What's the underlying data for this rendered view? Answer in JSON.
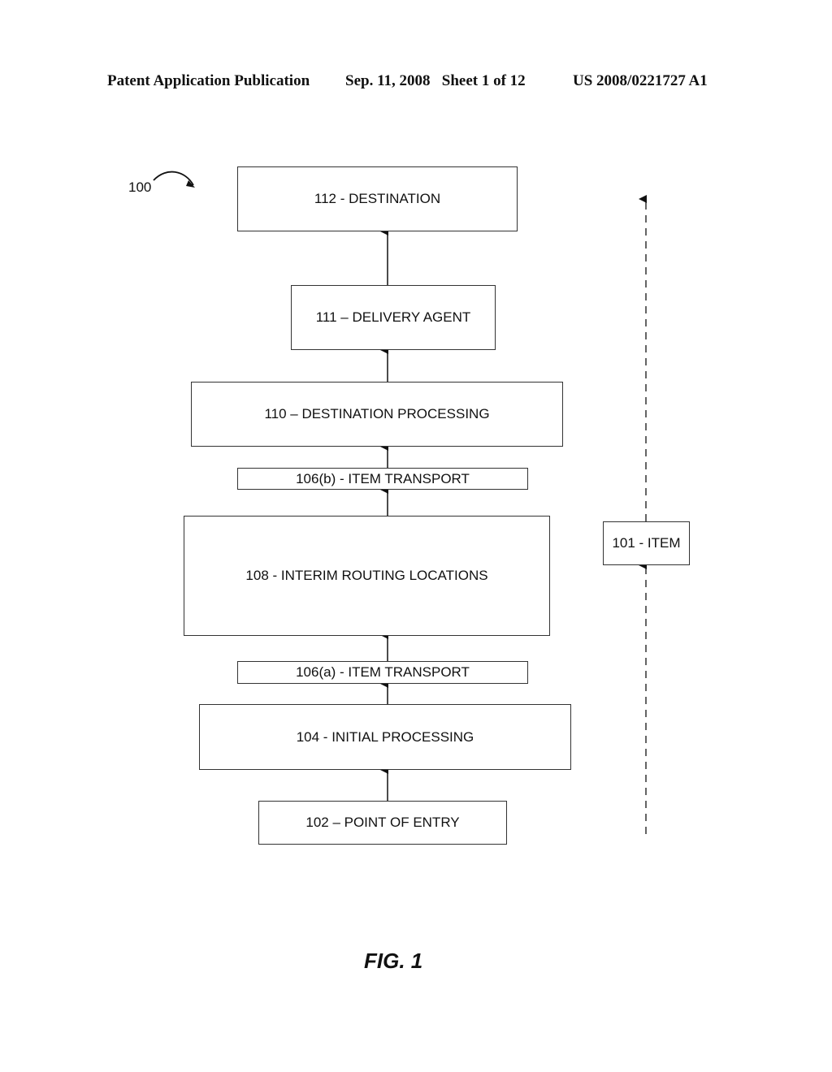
{
  "header": {
    "left": "Patent Application Publication",
    "middle": "Sep. 11, 2008   Sheet 1 of 12",
    "right": "US 2008/0221727 A1"
  },
  "figure": {
    "reference_label": "100",
    "caption": "FIG. 1",
    "boxes": {
      "destination": "112 - DESTINATION",
      "delivery_agent": "111 – DELIVERY AGENT",
      "destination_processing": "110 – DESTINATION PROCESSING",
      "item_transport_b": "106(b) - ITEM TRANSPORT",
      "interim_routing": "108 - INTERIM ROUTING LOCATIONS",
      "item_transport_a": "106(a) - ITEM TRANSPORT",
      "initial_processing": "104 - INITIAL PROCESSING",
      "point_of_entry": "102 – POINT OF ENTRY",
      "item": "101 - ITEM"
    },
    "flow_order": [
      "102 – POINT OF ENTRY",
      "104 - INITIAL PROCESSING",
      "106(a) - ITEM TRANSPORT",
      "108 - INTERIM ROUTING LOCATIONS",
      "106(b) - ITEM TRANSPORT",
      "110 – DESTINATION PROCESSING",
      "111 – DELIVERY AGENT",
      "112 - DESTINATION"
    ]
  }
}
